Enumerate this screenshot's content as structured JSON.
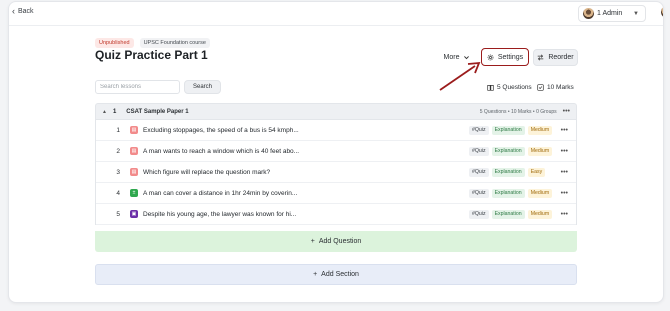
{
  "nav": {
    "back_label": "Back"
  },
  "user": {
    "name": "1 Admin"
  },
  "header": {
    "status_badge": "Unpublished",
    "course_badge": "UPSC Foundation course",
    "title": "Quiz Practice Part 1",
    "more_label": "More",
    "settings_label": "Settings",
    "reorder_label": "Reorder"
  },
  "search": {
    "placeholder": "Search lessons",
    "button_label": "Search"
  },
  "stats": {
    "questions": "5 Questions",
    "marks": "10 Marks"
  },
  "section": {
    "number": "1",
    "name": "CSAT Sample Paper 1",
    "meta": "5 Questions  •  10 Marks  •  0 Groups",
    "questions": [
      {
        "index": "1",
        "text": "Excluding stoppages, the speed of a bus is 54 kmph...",
        "icon": "question-type-icon",
        "icon_color": "#f28b8b",
        "tags": [
          "#Quiz",
          "Explanation",
          "Medium"
        ]
      },
      {
        "index": "2",
        "text": "A man wants to reach a window which is 40 feet abo...",
        "icon": "question-type-icon",
        "icon_color": "#f28b8b",
        "tags": [
          "#Quiz",
          "Explanation",
          "Medium"
        ]
      },
      {
        "index": "3",
        "text": "Which figure will replace the question mark?",
        "icon": "question-type-icon",
        "icon_color": "#f28b8b",
        "tags": [
          "#Quiz",
          "Explanation",
          "Easy"
        ]
      },
      {
        "index": "4",
        "text": "A man can cover a distance in 1hr 24min by coverin...",
        "icon": "calculation-icon",
        "icon_color": "#2fa84f",
        "tags": [
          "#Quiz",
          "Explanation",
          "Medium"
        ]
      },
      {
        "index": "5",
        "text": "Despite his young age, the lawyer was known for hi...",
        "icon": "document-question-icon",
        "icon_color": "#6b2fa8",
        "tags": [
          "#Quiz",
          "Explanation",
          "Medium"
        ]
      }
    ]
  },
  "actions": {
    "add_question": "Add Question",
    "add_section": "Add Section"
  },
  "colors": {
    "highlight": "#9b1c1c",
    "add_question_bg": "#dcf3dc",
    "add_section_bg": "#e8edf8"
  }
}
